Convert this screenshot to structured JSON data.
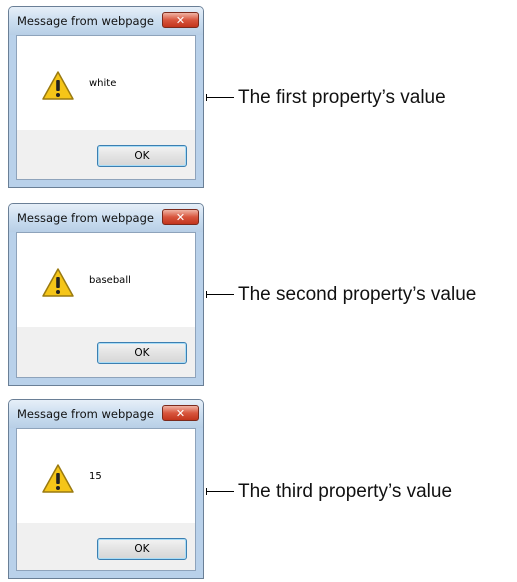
{
  "dialogs": [
    {
      "title": "Message from webpage",
      "close_glyph": "✕",
      "icon": "warning-icon",
      "message": "white",
      "ok_label": "OK",
      "callout": "The first property’s value"
    },
    {
      "title": "Message from webpage",
      "close_glyph": "✕",
      "icon": "warning-icon",
      "message": "baseball",
      "ok_label": "OK",
      "callout": "The second property’s value"
    },
    {
      "title": "Message from webpage",
      "close_glyph": "✕",
      "icon": "warning-icon",
      "message": "15",
      "ok_label": "OK",
      "callout": "The third property’s value"
    }
  ],
  "colors": {
    "frame": "#b9d1ea",
    "close_button": "#c8442a",
    "warning_fill": "#f5c518",
    "ok_border": "#3c7fb1"
  }
}
